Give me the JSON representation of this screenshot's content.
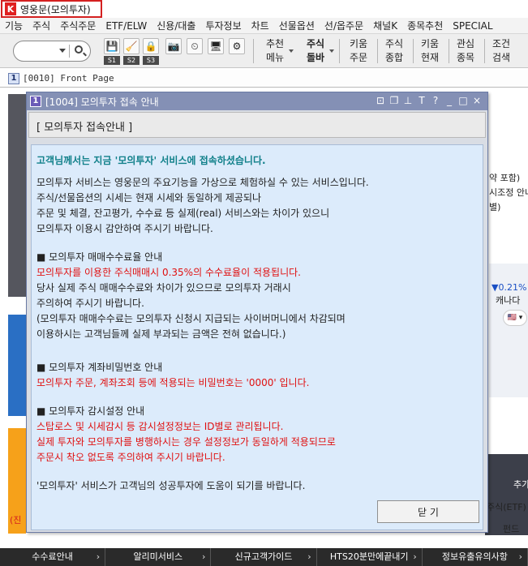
{
  "app": {
    "logo": "K",
    "title": "영웅문(모의투자)"
  },
  "menu": [
    "기능",
    "주식",
    "주식주문",
    "ETF/ELW",
    "신용/대출",
    "투자정보",
    "차트",
    "선물옵션",
    "선/옵주문",
    "채널K",
    "종목추천",
    "SPECIAL"
  ],
  "toolbar": {
    "slots": [
      "S1",
      "S2",
      "S3"
    ],
    "buttons": [
      {
        "line1": "추천",
        "line2": "메뉴"
      },
      {
        "line1": "주식",
        "line2": "돌바"
      },
      {
        "line1": "키움",
        "line2": "주문"
      },
      {
        "line1": "주식",
        "line2": "종합"
      },
      {
        "line1": "키움",
        "line2": "현재"
      },
      {
        "line1": "관심",
        "line2": "종목"
      },
      {
        "line1": "조건",
        "line2": "검색"
      }
    ]
  },
  "front_page": {
    "number": "1",
    "label": "[0010] Front Page"
  },
  "background": {
    "fragments": [
      "약 포함)",
      "시조정 안내",
      "별)",
      "▼0.21%",
      "캐나다",
      "추가",
      "주식(ETF)",
      "펀드",
      "(진"
    ],
    "flag_label": "🇺🇸 ▾",
    "bottom_nav": [
      "수수료안내",
      "알리미서비스",
      "신규고객가이드",
      "HTS20분만에끝내기",
      "정보유출유의사항"
    ]
  },
  "dialog": {
    "number": "1",
    "title": "[1004] 모의투자 접속 안내",
    "controls": [
      "⊡",
      "❐",
      "⊥",
      "T",
      "?",
      "_",
      "□",
      "×"
    ],
    "header": "[ 모의투자 접속안내 ]",
    "headline": "고객님께서는 지금 '모의투자' 서비스에 접속하셨습니다.",
    "intro": [
      "모의투자 서비스는 영웅문의 주요기능을 가상으로 체험하실 수 있는 서비스입니다.",
      "주식/선물옵션의 시세는 현재 시세와 동일하게 제공되나",
      "주문 및 체결, 잔고평가, 수수료 등 실제(real) 서비스와는 차이가 있으니",
      "모의투자 이용시 감안하여 주시기 바랍니다."
    ],
    "fee_section": {
      "heading": "■ 모의투자 매매수수료율 안내",
      "red": "모의투자를 이용한 주식매매시 0.35%의 수수료율이 적용됩니다.",
      "lines": [
        "당사 실제 주식 매매수수료와 차이가 있으므로 모의투자 거래시",
        "주의하여 주시기 바랍니다.",
        "(모의투자 매매수수료는 모의투자 신청시 지급되는 사이버머니에서 차감되며",
        "이용하시는 고객님들께 실제 부과되는 금액은 전혀 없습니다.)"
      ]
    },
    "pw_section": {
      "heading": "■ 모의투자 계좌비밀번호 안내",
      "red": "모의투자 주문, 계좌조회 등에 적용되는 비밀번호는 '0000' 입니다."
    },
    "watch_section": {
      "heading": "■ 모의투자 감시설정 안내",
      "red": [
        "스탑로스 및 시세감시 등 감시설정정보는 ID별로 관리됩니다.",
        "실제 투자와 모의투자를 병행하시는 경우 설정정보가 동일하게 적용되므로",
        "주문시 착오 없도록 주의하여 주시기 바랍니다."
      ]
    },
    "closing": "'모의투자' 서비스가 고객님의 성공투자에 도움이 되기를 바랍니다.",
    "close_button": "닫 기"
  }
}
